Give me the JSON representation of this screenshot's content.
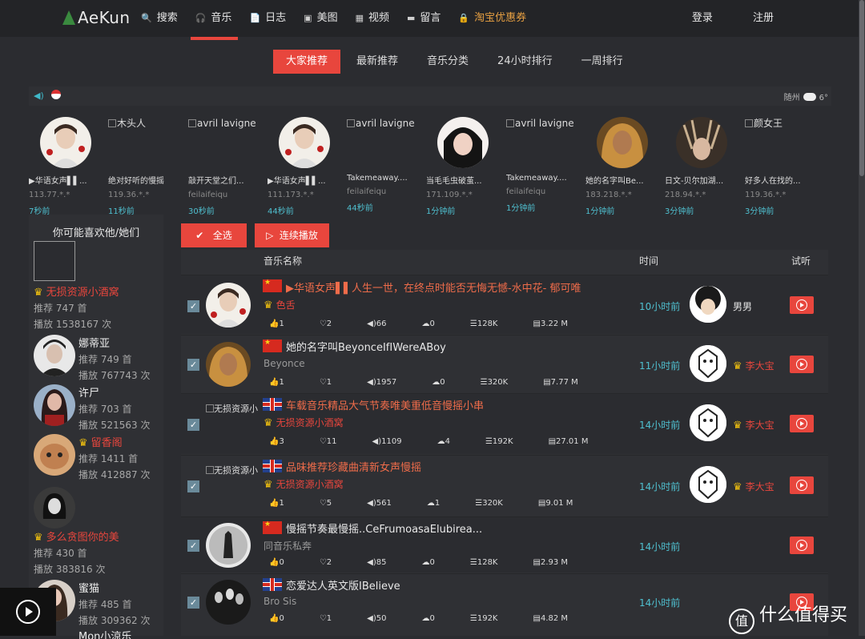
{
  "header": {
    "logo": "AeKun",
    "nav": [
      {
        "icon": "search-icon",
        "glyph": "🔍",
        "label": "搜索"
      },
      {
        "icon": "headphones-icon",
        "glyph": "🎧",
        "label": "音乐"
      },
      {
        "icon": "document-icon",
        "glyph": "📄",
        "label": "日志"
      },
      {
        "icon": "image-icon",
        "glyph": "▣",
        "label": "美图"
      },
      {
        "icon": "video-icon",
        "glyph": "▦",
        "label": "视频"
      },
      {
        "icon": "message-icon",
        "glyph": "▬",
        "label": "留言"
      },
      {
        "icon": "lock-icon",
        "glyph": "🔒",
        "label": "淘宝优惠券"
      }
    ],
    "login": "登录",
    "register": "注册"
  },
  "tabs": [
    "大家推荐",
    "最新推荐",
    "音乐分类",
    "24小时排行",
    "一周排行"
  ],
  "weather": {
    "city": "随州",
    "temp": "6°"
  },
  "recent": [
    {
      "avatar": "rose-man",
      "title": "▶华语女声▌▌...",
      "ip": "113.77.*.*",
      "time": "7秒前"
    },
    {
      "alt": "木头人",
      "title": "绝对好听的慢摇",
      "ip": "119.36.*.*",
      "time": "11秒前"
    },
    {
      "alt": "avril lavigne",
      "title": "敲开天堂之们...",
      "ip": "feilaifeiqu",
      "time": "30秒前"
    },
    {
      "avatar": "rose-man",
      "title": "▶华语女声▌▌...",
      "ip": "111.173.*.*",
      "time": "44秒前"
    },
    {
      "alt": "avril lavigne",
      "title": "Takemeaway....",
      "ip": "feilaifeiqu",
      "time": "44秒前"
    },
    {
      "avatar": "girl-black",
      "title": "当毛毛虫破茧...",
      "ip": "171.109.*.*",
      "time": "1分钟前"
    },
    {
      "alt": "avril lavigne",
      "title": "Takemeaway....",
      "ip": "feilaifeiqu",
      "time": "1分钟前"
    },
    {
      "avatar": "beyonce",
      "title": "她的名字叫Be...",
      "ip": "183.218.*.*",
      "time": "1分钟前"
    },
    {
      "avatar": "feather",
      "title": "日文-贝尔加湖...",
      "ip": "218.94.*.*",
      "time": "3分钟前"
    },
    {
      "alt": "颜女王",
      "title": "好多人在找的...",
      "ip": "119.36.*.*",
      "time": "3分钟前"
    }
  ],
  "sidebar": {
    "title": "你可能喜欢他/她们",
    "people": [
      {
        "name": "无损资源小酒窝",
        "crown": true,
        "rec": "推荐 747 首",
        "plays": "播放 1538167 次"
      },
      {
        "name": "娜蒂亚",
        "rec": "推荐 749 首",
        "plays": "播放 767743 次"
      },
      {
        "name": "许尸",
        "rec": "推荐 703 首",
        "plays": "播放 521563 次"
      },
      {
        "name": "留香阁",
        "crown": true,
        "rec": "推荐 1411 首",
        "plays": "播放 412887 次"
      },
      {
        "name": "多么贪图你的美",
        "crown": true,
        "rec": "推荐 430 首",
        "plays": "播放 383816 次"
      },
      {
        "name": "蜜猫",
        "rec": "推荐 485 首",
        "plays": "播放 309362 次"
      },
      {
        "name": "Mon小涼乐"
      }
    ]
  },
  "buttons": {
    "select_all": "全选",
    "continuous": "连续播放"
  },
  "list": {
    "headers": {
      "name": "音乐名称",
      "time": "时间",
      "listen": "试听"
    },
    "rows": [
      {
        "flag": "cn",
        "title": "▶华语女声▌▌人生一世，在终点时能否无悔无憾-水中花- 郁可唯",
        "artist": "色舌",
        "artist_crown": true,
        "likes": "1",
        "hearts": "2",
        "plays": "66",
        "downloads": "0",
        "size": "128K",
        "file": "3.22 M",
        "time": "10小时前",
        "user": "男男",
        "user_crown": false
      },
      {
        "flag": "cn",
        "title": "她的名字叫BeyonceIfIWereABoy",
        "artist": "Beyonce",
        "artist_crown": false,
        "likes": "1",
        "hearts": "1",
        "plays": "1957",
        "downloads": "0",
        "size": "320K",
        "file": "7.77 M",
        "time": "11小时前",
        "user": "李大宝",
        "user_crown": true
      },
      {
        "flag": "uk",
        "cover_alt": "无损资源小",
        "title": "车载音乐精品大气节奏唯美重低音慢摇小串",
        "artist": "无损资源小酒窝",
        "artist_crown": true,
        "likes": "3",
        "hearts": "11",
        "plays": "1109",
        "downloads": "4",
        "size": "192K",
        "file": "27.01 M",
        "time": "14小时前",
        "user": "李大宝",
        "user_crown": true
      },
      {
        "flag": "uk",
        "cover_alt": "无损资源小",
        "title": "品味推荐珍藏曲清新女声慢摇",
        "artist": "无损资源小酒窝",
        "artist_crown": true,
        "likes": "1",
        "hearts": "5",
        "plays": "561",
        "downloads": "1",
        "size": "320K",
        "file": "9.01 M",
        "time": "14小时前",
        "user": "李大宝",
        "user_crown": true
      },
      {
        "flag": "cn",
        "title": "慢摇节奏最慢摇..CeFrumoasaElubirea...",
        "artist": "同音乐私奔",
        "artist_crown": false,
        "likes": "0",
        "hearts": "2",
        "plays": "85",
        "downloads": "0",
        "size": "128K",
        "file": "2.93 M",
        "time": "14小时前",
        "user": "",
        "user_crown": false
      },
      {
        "flag": "uk",
        "title": "恋爱达人英文版IBelieve",
        "artist": "Bro Sis",
        "artist_crown": false,
        "likes": "0",
        "hearts": "1",
        "plays": "50",
        "downloads": "0",
        "size": "192K",
        "file": "4.82 M",
        "time": "14小时前",
        "user": "",
        "user_crown": false
      }
    ]
  },
  "watermark": "什么值得买",
  "watermark_logo": "值"
}
